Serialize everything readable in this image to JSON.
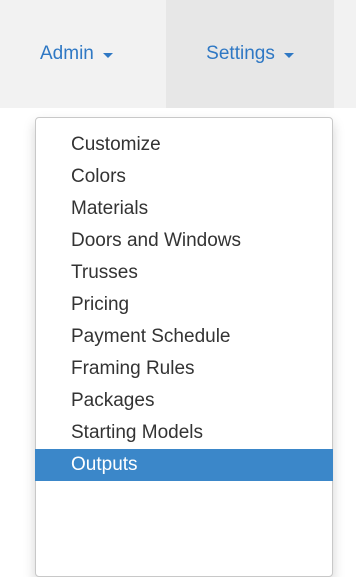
{
  "navbar": {
    "admin_label": "Admin",
    "settings_label": "Settings"
  },
  "settings_menu": {
    "items": [
      {
        "label": "Customize"
      },
      {
        "label": "Colors"
      },
      {
        "label": "Materials"
      },
      {
        "label": "Doors and Windows"
      },
      {
        "label": "Trusses"
      },
      {
        "label": "Pricing"
      },
      {
        "label": "Payment Schedule"
      },
      {
        "label": "Framing Rules"
      },
      {
        "label": "Packages"
      },
      {
        "label": "Starting Models"
      },
      {
        "label": "Outputs",
        "highlighted": true
      }
    ]
  },
  "colors": {
    "link": "#2f78c4",
    "highlight": "#3b87c9",
    "navbar_bg": "#f2f2f2",
    "open_nav_bg": "#e7e7e7"
  },
  "icons": {
    "dropdown_caret": "caret-down-icon"
  }
}
